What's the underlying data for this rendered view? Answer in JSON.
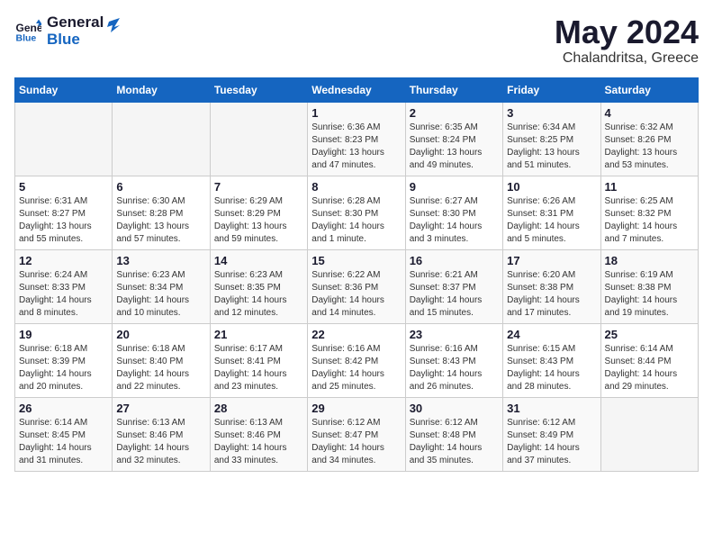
{
  "header": {
    "logo_line1": "General",
    "logo_line2": "Blue",
    "month": "May 2024",
    "location": "Chalandritsa, Greece"
  },
  "weekdays": [
    "Sunday",
    "Monday",
    "Tuesday",
    "Wednesday",
    "Thursday",
    "Friday",
    "Saturday"
  ],
  "weeks": [
    [
      {
        "day": "",
        "sunrise": "",
        "sunset": "",
        "daylight": ""
      },
      {
        "day": "",
        "sunrise": "",
        "sunset": "",
        "daylight": ""
      },
      {
        "day": "",
        "sunrise": "",
        "sunset": "",
        "daylight": ""
      },
      {
        "day": "1",
        "sunrise": "Sunrise: 6:36 AM",
        "sunset": "Sunset: 8:23 PM",
        "daylight": "Daylight: 13 hours and 47 minutes."
      },
      {
        "day": "2",
        "sunrise": "Sunrise: 6:35 AM",
        "sunset": "Sunset: 8:24 PM",
        "daylight": "Daylight: 13 hours and 49 minutes."
      },
      {
        "day": "3",
        "sunrise": "Sunrise: 6:34 AM",
        "sunset": "Sunset: 8:25 PM",
        "daylight": "Daylight: 13 hours and 51 minutes."
      },
      {
        "day": "4",
        "sunrise": "Sunrise: 6:32 AM",
        "sunset": "Sunset: 8:26 PM",
        "daylight": "Daylight: 13 hours and 53 minutes."
      }
    ],
    [
      {
        "day": "5",
        "sunrise": "Sunrise: 6:31 AM",
        "sunset": "Sunset: 8:27 PM",
        "daylight": "Daylight: 13 hours and 55 minutes."
      },
      {
        "day": "6",
        "sunrise": "Sunrise: 6:30 AM",
        "sunset": "Sunset: 8:28 PM",
        "daylight": "Daylight: 13 hours and 57 minutes."
      },
      {
        "day": "7",
        "sunrise": "Sunrise: 6:29 AM",
        "sunset": "Sunset: 8:29 PM",
        "daylight": "Daylight: 13 hours and 59 minutes."
      },
      {
        "day": "8",
        "sunrise": "Sunrise: 6:28 AM",
        "sunset": "Sunset: 8:30 PM",
        "daylight": "Daylight: 14 hours and 1 minute."
      },
      {
        "day": "9",
        "sunrise": "Sunrise: 6:27 AM",
        "sunset": "Sunset: 8:30 PM",
        "daylight": "Daylight: 14 hours and 3 minutes."
      },
      {
        "day": "10",
        "sunrise": "Sunrise: 6:26 AM",
        "sunset": "Sunset: 8:31 PM",
        "daylight": "Daylight: 14 hours and 5 minutes."
      },
      {
        "day": "11",
        "sunrise": "Sunrise: 6:25 AM",
        "sunset": "Sunset: 8:32 PM",
        "daylight": "Daylight: 14 hours and 7 minutes."
      }
    ],
    [
      {
        "day": "12",
        "sunrise": "Sunrise: 6:24 AM",
        "sunset": "Sunset: 8:33 PM",
        "daylight": "Daylight: 14 hours and 8 minutes."
      },
      {
        "day": "13",
        "sunrise": "Sunrise: 6:23 AM",
        "sunset": "Sunset: 8:34 PM",
        "daylight": "Daylight: 14 hours and 10 minutes."
      },
      {
        "day": "14",
        "sunrise": "Sunrise: 6:23 AM",
        "sunset": "Sunset: 8:35 PM",
        "daylight": "Daylight: 14 hours and 12 minutes."
      },
      {
        "day": "15",
        "sunrise": "Sunrise: 6:22 AM",
        "sunset": "Sunset: 8:36 PM",
        "daylight": "Daylight: 14 hours and 14 minutes."
      },
      {
        "day": "16",
        "sunrise": "Sunrise: 6:21 AM",
        "sunset": "Sunset: 8:37 PM",
        "daylight": "Daylight: 14 hours and 15 minutes."
      },
      {
        "day": "17",
        "sunrise": "Sunrise: 6:20 AM",
        "sunset": "Sunset: 8:38 PM",
        "daylight": "Daylight: 14 hours and 17 minutes."
      },
      {
        "day": "18",
        "sunrise": "Sunrise: 6:19 AM",
        "sunset": "Sunset: 8:38 PM",
        "daylight": "Daylight: 14 hours and 19 minutes."
      }
    ],
    [
      {
        "day": "19",
        "sunrise": "Sunrise: 6:18 AM",
        "sunset": "Sunset: 8:39 PM",
        "daylight": "Daylight: 14 hours and 20 minutes."
      },
      {
        "day": "20",
        "sunrise": "Sunrise: 6:18 AM",
        "sunset": "Sunset: 8:40 PM",
        "daylight": "Daylight: 14 hours and 22 minutes."
      },
      {
        "day": "21",
        "sunrise": "Sunrise: 6:17 AM",
        "sunset": "Sunset: 8:41 PM",
        "daylight": "Daylight: 14 hours and 23 minutes."
      },
      {
        "day": "22",
        "sunrise": "Sunrise: 6:16 AM",
        "sunset": "Sunset: 8:42 PM",
        "daylight": "Daylight: 14 hours and 25 minutes."
      },
      {
        "day": "23",
        "sunrise": "Sunrise: 6:16 AM",
        "sunset": "Sunset: 8:43 PM",
        "daylight": "Daylight: 14 hours and 26 minutes."
      },
      {
        "day": "24",
        "sunrise": "Sunrise: 6:15 AM",
        "sunset": "Sunset: 8:43 PM",
        "daylight": "Daylight: 14 hours and 28 minutes."
      },
      {
        "day": "25",
        "sunrise": "Sunrise: 6:14 AM",
        "sunset": "Sunset: 8:44 PM",
        "daylight": "Daylight: 14 hours and 29 minutes."
      }
    ],
    [
      {
        "day": "26",
        "sunrise": "Sunrise: 6:14 AM",
        "sunset": "Sunset: 8:45 PM",
        "daylight": "Daylight: 14 hours and 31 minutes."
      },
      {
        "day": "27",
        "sunrise": "Sunrise: 6:13 AM",
        "sunset": "Sunset: 8:46 PM",
        "daylight": "Daylight: 14 hours and 32 minutes."
      },
      {
        "day": "28",
        "sunrise": "Sunrise: 6:13 AM",
        "sunset": "Sunset: 8:46 PM",
        "daylight": "Daylight: 14 hours and 33 minutes."
      },
      {
        "day": "29",
        "sunrise": "Sunrise: 6:12 AM",
        "sunset": "Sunset: 8:47 PM",
        "daylight": "Daylight: 14 hours and 34 minutes."
      },
      {
        "day": "30",
        "sunrise": "Sunrise: 6:12 AM",
        "sunset": "Sunset: 8:48 PM",
        "daylight": "Daylight: 14 hours and 35 minutes."
      },
      {
        "day": "31",
        "sunrise": "Sunrise: 6:12 AM",
        "sunset": "Sunset: 8:49 PM",
        "daylight": "Daylight: 14 hours and 37 minutes."
      },
      {
        "day": "",
        "sunrise": "",
        "sunset": "",
        "daylight": ""
      }
    ]
  ]
}
